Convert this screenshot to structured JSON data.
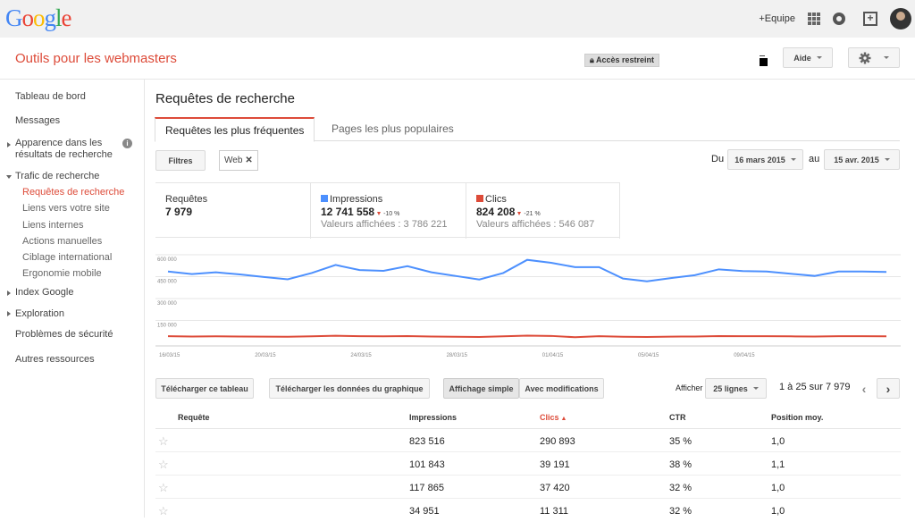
{
  "brand": {
    "logo_letters": [
      {
        "c": "G",
        "color": "#4285f4"
      },
      {
        "c": "o",
        "color": "#ea4335"
      },
      {
        "c": "o",
        "color": "#fbbc05"
      },
      {
        "c": "g",
        "color": "#4285f4"
      },
      {
        "c": "l",
        "color": "#34a853"
      },
      {
        "c": "e",
        "color": "#ea4335"
      }
    ]
  },
  "topbar": {
    "plus_label": "+Equipe",
    "icons": [
      "apps-icon",
      "notifications-icon",
      "share-icon",
      "avatar"
    ]
  },
  "header": {
    "product": "Outils pour les webmasters",
    "restricted_label": "Accès restreint",
    "help_label": "Aide",
    "settings_icon": "gear-icon"
  },
  "sidebar": {
    "dashboard": "Tableau de bord",
    "messages": "Messages",
    "appearance": [
      "Apparence dans les",
      "résultats de recherche"
    ],
    "traffic": "Trafic de recherche",
    "traffic_items": [
      "Requêtes de recherche",
      "Liens vers votre site",
      "Liens internes",
      "Actions manuelles",
      "Ciblage international",
      "Ergonomie mobile"
    ],
    "index": "Index Google",
    "crawl": "Exploration",
    "security": "Problèmes de sécurité",
    "other": "Autres ressources"
  },
  "main": {
    "title": "Requêtes de recherche",
    "tabs": [
      "Requêtes les plus fréquentes",
      "Pages les plus populaires"
    ],
    "filters_label": "Filtres",
    "chip_label": "Web",
    "date_from_label": "Du",
    "date_from": "16 mars 2015",
    "date_to_label": "au",
    "date_to": "15 avr. 2015"
  },
  "stats": [
    {
      "title": "Requêtes",
      "value": "7 979",
      "delta": "",
      "sub": "",
      "color": ""
    },
    {
      "title": "Impressions",
      "value": "12 741 558",
      "delta": "-10 %",
      "sub": "Valeurs affichées : 3 786 221",
      "color": "#4d90fe"
    },
    {
      "title": "Clics",
      "value": "824 208",
      "delta": "-21 %",
      "sub": "Valeurs affichées : 546 087",
      "color": "#dd4b39"
    }
  ],
  "chart_data": {
    "type": "line",
    "x": [
      "16/03/15",
      "17/03/15",
      "18/03/15",
      "19/03/15",
      "20/03/15",
      "21/03/15",
      "22/03/15",
      "23/03/15",
      "24/03/15",
      "25/03/15",
      "26/03/15",
      "27/03/15",
      "28/03/15",
      "29/03/15",
      "30/03/15",
      "31/03/15",
      "01/04/15",
      "02/04/15",
      "03/04/15",
      "04/04/15",
      "05/04/15",
      "06/04/15",
      "07/04/15",
      "08/04/15",
      "09/04/15",
      "10/04/15",
      "11/04/15",
      "12/04/15",
      "13/04/15",
      "14/04/15",
      "15/04/15"
    ],
    "xticks": [
      "16/03/15",
      "20/03/15",
      "24/03/15",
      "28/03/15",
      "01/04/15",
      "05/04/15",
      "09/04/15"
    ],
    "yticks": [
      "600 000",
      "450 000",
      "300 000",
      "150 000"
    ],
    "ylim": [
      0,
      600000
    ],
    "grid": true,
    "series": [
      {
        "name": "Impressions",
        "color": "#4d90fe",
        "values": [
          485000,
          468000,
          480000,
          465000,
          448000,
          432000,
          475000,
          530000,
          495000,
          490000,
          522000,
          480000,
          455000,
          430000,
          475000,
          565000,
          545000,
          515000,
          515000,
          437000,
          418000,
          440000,
          460000,
          500000,
          488000,
          485000,
          470000,
          455000,
          485000,
          485000,
          482000
        ]
      },
      {
        "name": "Clics",
        "color": "#dd4b39",
        "values": [
          42000,
          40000,
          41000,
          40000,
          39000,
          38000,
          41000,
          45000,
          42000,
          41000,
          43000,
          40000,
          38000,
          37000,
          41000,
          46000,
          44000,
          35000,
          42000,
          38000,
          37000,
          39000,
          40000,
          43000,
          42000,
          42000,
          41000,
          40000,
          42000,
          42000,
          41000
        ]
      }
    ]
  },
  "toolbar": {
    "download_table": "Télécharger ce tableau",
    "download_chart": "Télécharger les données du graphique",
    "simple_view": "Affichage simple",
    "with_changes": "Avec modifications",
    "show_label": "Afficher",
    "rows_select": "25 lignes",
    "pagination": "1 à 25 sur 7 979"
  },
  "table": {
    "headers": [
      "Requête",
      "Impressions",
      "Clics",
      "CTR",
      "Position moy."
    ],
    "rows": [
      {
        "query": "",
        "impressions": "823 516",
        "clicks": "290 893",
        "ctr": "35 %",
        "position": "1,0"
      },
      {
        "query": "",
        "impressions": "101 843",
        "clicks": "39 191",
        "ctr": "38 %",
        "position": "1,1"
      },
      {
        "query": "",
        "impressions": "117 865",
        "clicks": "37 420",
        "ctr": "32 %",
        "position": "1,0"
      },
      {
        "query": "",
        "impressions": "34 951",
        "clicks": "11 311",
        "ctr": "32 %",
        "position": "1,0"
      }
    ]
  }
}
